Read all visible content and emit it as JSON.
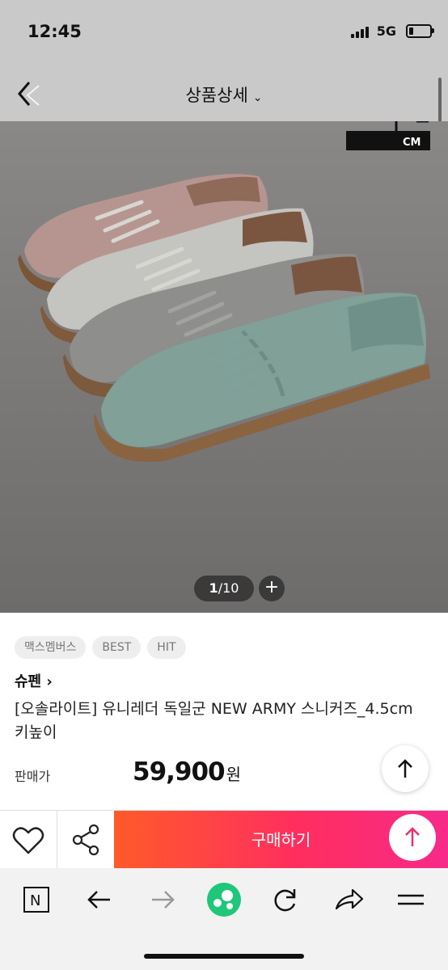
{
  "status": {
    "time": "12:45",
    "network": "5G"
  },
  "nav": {
    "title": "상품상세",
    "title_chevron": "⌄"
  },
  "hero": {
    "size_badge": "CM",
    "counter_current": "1",
    "counter_total": "/10",
    "plus_label": "+"
  },
  "tags": [
    "맥스멤버스",
    "BEST",
    "HIT"
  ],
  "product": {
    "brand": "슈펜 ›",
    "name": "[오솔라이트] 유니레더 독일군 NEW ARMY 스니커즈_4.5cm키높이",
    "price_label": "판매가",
    "price": "59,900",
    "currency": "원"
  },
  "buybar": {
    "buy_label": "구매하기"
  },
  "browser": {
    "n_button": "N"
  },
  "colors": {
    "buy_gradient_start": "#ff5a2a",
    "buy_gradient_end": "#f72a8a",
    "status_bg": "#c9c9c9",
    "browser_accent": "#1ec77a"
  },
  "icons": [
    "back-icon",
    "chevron-down-icon",
    "plus-icon",
    "arrow-up-icon",
    "heart-icon",
    "share-icon",
    "n-icon",
    "arrow-left-icon",
    "arrow-right-icon",
    "green-app-icon",
    "refresh-icon",
    "forward-share-icon",
    "menu-icon"
  ]
}
